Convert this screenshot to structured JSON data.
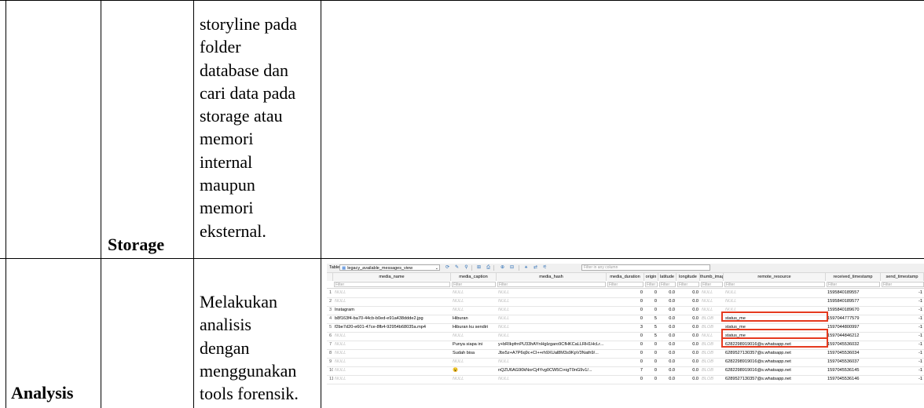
{
  "document": {
    "storage_row": {
      "label": "Storage",
      "description_lines": [
        "storyline pada",
        "folder",
        "database dan",
        "cari data pada",
        "storage atau",
        "memori",
        "internal",
        "maupun",
        "memori",
        "eksternal."
      ]
    },
    "analysis_row": {
      "label": "Analysis",
      "description_lines": [
        "Melakukan",
        "analisis",
        "dengan",
        "menggunakan",
        "tools forensik."
      ]
    }
  },
  "screenshot": {
    "toolbar": {
      "table_label": "Table:",
      "table_value": "legacy_available_messages_view",
      "filter_placeholder": "Filter in any column"
    },
    "columns": [
      "media_name",
      "media_caption",
      "media_hash",
      "media_duration",
      "origin",
      "latitude",
      "longitude",
      "thumb_image",
      "remote_resource",
      "received_timestamp",
      "send_timestamp"
    ],
    "filter_placeholder": "Filter",
    "rows": [
      {
        "n": "1",
        "media_name": "NULL",
        "media_caption": "NULL",
        "media_hash": "NULL",
        "media_duration": "0",
        "origin": "0",
        "latitude": "0.0",
        "longitude": "0.0",
        "thumb_image": "NULL",
        "remote_resource": "NULL",
        "received_timestamp": "1595840189557",
        "send_timestamp": "-1"
      },
      {
        "n": "2",
        "media_name": "NULL",
        "media_caption": "NULL",
        "media_hash": "NULL",
        "media_duration": "0",
        "origin": "0",
        "latitude": "0.0",
        "longitude": "0.0",
        "thumb_image": "NULL",
        "remote_resource": "NULL",
        "received_timestamp": "1595840189577",
        "send_timestamp": "-1"
      },
      {
        "n": "3",
        "media_name": "Instagram",
        "media_caption": "NULL",
        "media_hash": "NULL",
        "media_duration": "0",
        "origin": "0",
        "latitude": "0.0",
        "longitude": "0.0",
        "thumb_image": "NULL",
        "remote_resource": "NULL",
        "received_timestamp": "1595840189670",
        "send_timestamp": "-1"
      },
      {
        "n": "4",
        "media_name": "b8f163f4-ba70-44cb-b0ed-e91a438ddde2.jpg",
        "media_caption": "Hiburan",
        "media_hash": "NULL",
        "media_duration": "0",
        "origin": "5",
        "latitude": "0.0",
        "longitude": "0.0",
        "thumb_image": "BLOB",
        "remote_resource": "status_me",
        "received_timestamp": "1597044777579",
        "send_timestamp": "-1"
      },
      {
        "n": "5",
        "media_name": "f2be7d20-e601-47ce-8fb4-92954b68035a.mp4",
        "media_caption": "Hiburan ku sendiri",
        "media_hash": "NULL",
        "media_duration": "3",
        "origin": "5",
        "latitude": "0.0",
        "longitude": "0.0",
        "thumb_image": "BLOB",
        "remote_resource": "status_me",
        "received_timestamp": "1597044800997",
        "send_timestamp": "-1"
      },
      {
        "n": "6",
        "media_name": "NULL",
        "media_caption": "NULL",
        "media_hash": "NULL",
        "media_duration": "0",
        "origin": "5",
        "latitude": "0.0",
        "longitude": "0.0",
        "thumb_image": "NULL",
        "remote_resource": "status_me",
        "received_timestamp": "1597044846212",
        "send_timestamp": "-1"
      },
      {
        "n": "7",
        "media_name": "NULL",
        "media_caption": "Punya siapa ini",
        "media_hash": "y+bRIkpfrnPU33hAYnHgIzgaro9CfHKCaLLRH1HcLr...",
        "media_duration": "0",
        "origin": "0",
        "latitude": "0.0",
        "longitude": "0.0",
        "thumb_image": "BLOB",
        "remote_resource": "6282298919016@s.whatsapp.net",
        "received_timestamp": "1597045536032",
        "send_timestamp": "-1"
      },
      {
        "n": "8",
        "media_name": "NULL",
        "media_caption": "Sudah bisa",
        "media_hash": "Jbx5z+A7P6q9c+CI++rh9XUal8M3s9KpV3Nath9/...",
        "media_duration": "0",
        "origin": "0",
        "latitude": "0.0",
        "longitude": "0.0",
        "thumb_image": "BLOB",
        "remote_resource": "6289527130357@s.whatsapp.net",
        "received_timestamp": "1597045536034",
        "send_timestamp": "-1"
      },
      {
        "n": "9",
        "media_name": "NULL",
        "media_caption": "NULL",
        "media_hash": "NULL",
        "media_duration": "0",
        "origin": "0",
        "latitude": "0.0",
        "longitude": "0.0",
        "thumb_image": "BLOB",
        "remote_resource": "6282298919016@s.whatsapp.net",
        "received_timestamp": "1597045536037",
        "send_timestamp": "-1"
      },
      {
        "n": "10",
        "media_name": "NULL",
        "media_caption": "😮",
        "media_hash": "nQZU6AG90kNorCj4Yvg0CW5Ci+igT0nG9v1/...",
        "media_duration": "7",
        "origin": "0",
        "latitude": "0.0",
        "longitude": "0.0",
        "thumb_image": "BLOB",
        "remote_resource": "6282298919016@s.whatsapp.net",
        "received_timestamp": "1597045536145",
        "send_timestamp": "-1"
      },
      {
        "n": "11",
        "media_name": "NULL",
        "media_caption": "NULL",
        "media_hash": "NULL",
        "media_duration": "0",
        "origin": "0",
        "latitude": "0.0",
        "longitude": "0.0",
        "thumb_image": "BLOB",
        "remote_resource": "6289527130357@s.whatsapp.net",
        "received_timestamp": "1597045536146",
        "send_timestamp": "-1"
      }
    ],
    "highlight_color": "#e53a1f"
  }
}
